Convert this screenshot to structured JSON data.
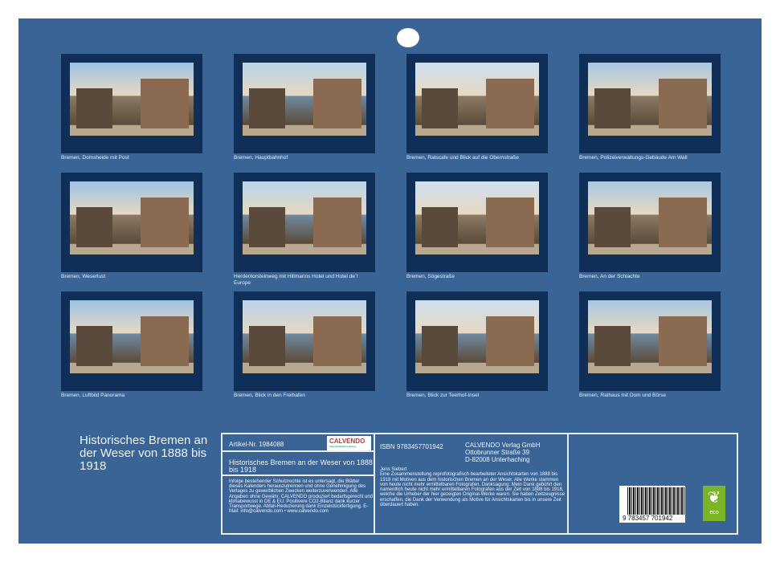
{
  "title": "Historisches Bremen an der Weser von 1888 bis 1918",
  "images": [
    "Bremen, Domsheide mit Post",
    "Bremen, Hauptbahnhof",
    "Bremen, Ratscafe und Blick auf die Obernstraße",
    "Bremen, Polizeiverwaltungs-Gebäude Am Wall",
    "Bremen, Weserlust",
    "Herdentorsteinweg mit Hillmanns Hotel und Hotel de´l Europe",
    "Bremen, Sögestraße",
    "Bremen, An der Schlachte",
    "Bremen, Luftbild Panorama",
    "Bremen, Blick in den Freihafen",
    "Bremen, Blick zur Teerhof-Insel",
    "Bremen, Rathaus mit Dom und Börse"
  ],
  "info": {
    "article": "Artikel-Nr. 1984088",
    "logo": "CALVENDO",
    "logo_sub": "Alles Kalenderordnung",
    "subtitle": "Historisches Bremen an der Weser von 1888 bis 1918",
    "legal": "Infolge bestehender Schutzrechte ist es untersagt, die Blätter dieses Kalenders herauszutrennen und ohne Genehmigung des Verlages zu gewerblichen Zwecken weiterzuverwenden. Alle Angaben ohne Gewähr. CALVENDO produziert bedarfsgerecht und klimabewusst in DE & EU. Positivere CO2-Bilanz dank kurzer Transportwege. Abfall-Reduzierung dank Einzelstückfertigung. E-Mail: info@calvendo.com • www.calvendo.com",
    "isbn": "ISBN 9783457701942",
    "publisher": [
      "CALVENDO Verlag GmbH",
      "Ottobrunner Straße 39",
      "D-82008 Unterhaching"
    ],
    "author": "Jens Siebert",
    "description": "Eine Zusammenstellung reprofotografisch bearbeiteter Ansichtskarten von 1888 bis 1918 mit Motiven aus dem historischen Bremen an der Weser. Alle Werke stammen von heute nicht mehr ermittelbaren Fotografen. Danksagung: Mein Dank gebührt den namentlich heute nicht mehr ermittelbaren Fotografen aus der Zeit von 1888 bis 1918, welche die Urheber der hier gezeigten Original-Werke waren. Sie haben Zeitzeugnisse erschaffen, die Dank der Verwendung als Motive für Ansichtskarten bis in unsere Zeit überdauert haben.",
    "barcode": "9 783457 701942",
    "eco": "eco"
  }
}
